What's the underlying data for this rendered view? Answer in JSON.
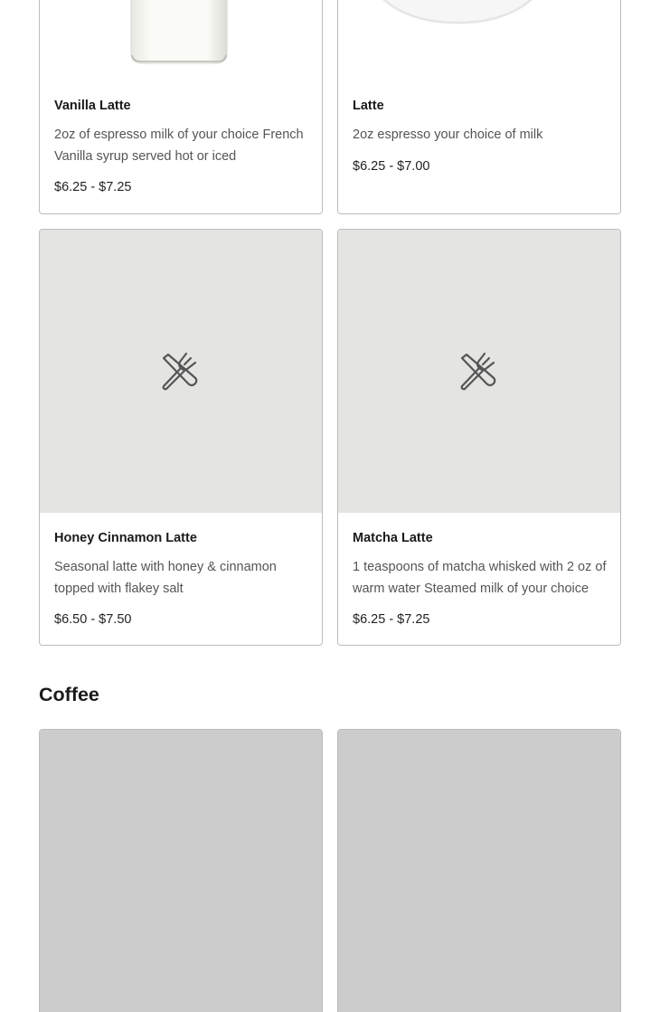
{
  "menu_items": [
    {
      "name": "Vanilla Latte",
      "description": "2oz of espresso milk of your choice French Vanilla syrup served hot or iced",
      "price": "$6.25 - $7.25",
      "image": "milk-glass-photo"
    },
    {
      "name": "Latte",
      "description": "2oz espresso your choice of milk",
      "price": "$6.25 - $7.00",
      "image": "latte-cup-photo"
    },
    {
      "name": "Honey Cinnamon Latte",
      "description": "Seasonal latte with honey & cinnamon topped with flakey salt",
      "price": "$6.50 - $7.50",
      "image": "utensils-placeholder-icon"
    },
    {
      "name": "Matcha Latte",
      "description": "1 teaspoons of matcha whisked with 2 oz of warm water Steamed milk of your choice",
      "price": "$6.25 - $7.25",
      "image": "utensils-placeholder-icon"
    }
  ],
  "sections": {
    "coffee_title": "Coffee"
  },
  "colors": {
    "placeholder_bg": "#e4e5e2",
    "loading_image_bg": "#cccccc",
    "card_border": "#bdbdbd"
  }
}
